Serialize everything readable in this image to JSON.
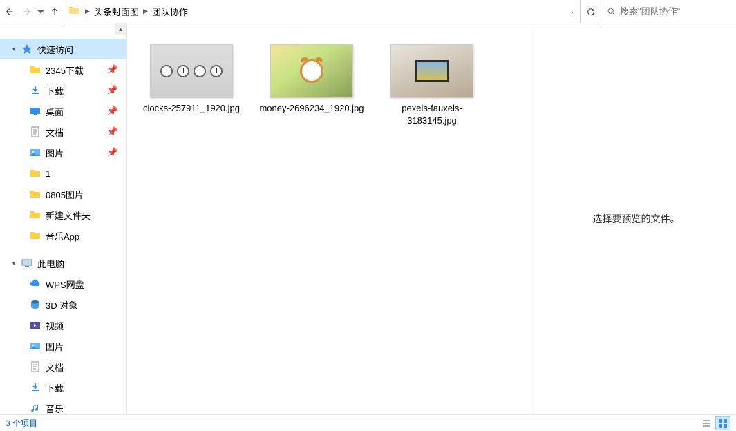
{
  "toolbar": {
    "address_root_icon": "folder-icon"
  },
  "breadcrumb": {
    "seg1": "头条封面图",
    "seg2": "团队协作"
  },
  "search": {
    "placeholder": "搜索\"团队协作\""
  },
  "sidebar": {
    "quick_access": {
      "label": "快速访问",
      "expanded": true
    },
    "items": [
      {
        "label": "2345下载",
        "icon": "folder",
        "pinned": true
      },
      {
        "label": "下载",
        "icon": "download",
        "pinned": true
      },
      {
        "label": "桌面",
        "icon": "desktop",
        "pinned": true
      },
      {
        "label": "文档",
        "icon": "document",
        "pinned": true
      },
      {
        "label": "图片",
        "icon": "pictures",
        "pinned": true
      },
      {
        "label": "1",
        "icon": "folder",
        "pinned": false
      },
      {
        "label": "0805图片",
        "icon": "folder",
        "pinned": false
      },
      {
        "label": "新建文件夹",
        "icon": "folder",
        "pinned": false
      },
      {
        "label": "音乐App",
        "icon": "folder",
        "pinned": false
      }
    ],
    "this_pc": {
      "label": "此电脑",
      "expanded": true
    },
    "pc_items": [
      {
        "label": "WPS网盘",
        "icon": "cloud"
      },
      {
        "label": "3D 对象",
        "icon": "3d"
      },
      {
        "label": "视频",
        "icon": "video"
      },
      {
        "label": "图片",
        "icon": "pictures"
      },
      {
        "label": "文档",
        "icon": "document"
      },
      {
        "label": "下载",
        "icon": "download"
      },
      {
        "label": "音乐",
        "icon": "music"
      }
    ]
  },
  "files": [
    {
      "name": "clocks-257911_1920.jpg",
      "thumb": "clocks"
    },
    {
      "name": "money-2696234_1920.jpg",
      "thumb": "money"
    },
    {
      "name": "pexels-fauxels-3183145.jpg",
      "thumb": "pexels"
    }
  ],
  "preview": {
    "empty_text": "选择要预览的文件。"
  },
  "statusbar": {
    "count_text": "3 个项目"
  }
}
